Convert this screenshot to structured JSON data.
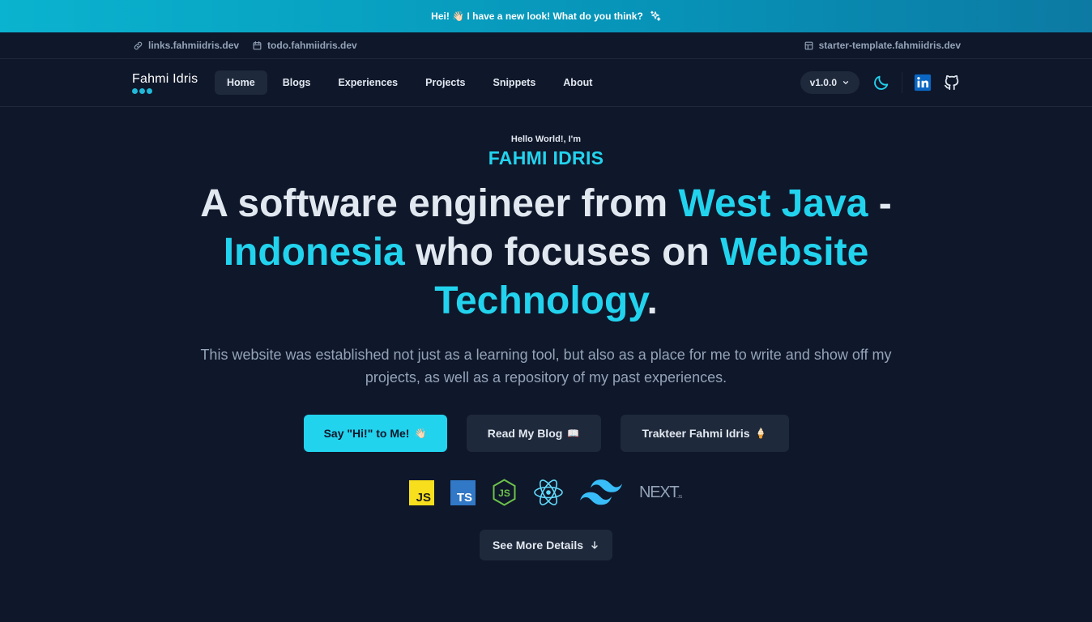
{
  "announcement": {
    "text": "Hei! 👋🏻 I have a new look! What do you think?",
    "icon": "sparkles-icon"
  },
  "topbar": {
    "links": [
      {
        "label": "links.fahmiidris.dev",
        "icon": "link-icon"
      },
      {
        "label": "todo.fahmiidris.dev",
        "icon": "calendar-icon"
      }
    ],
    "right_link": {
      "label": "starter-template.fahmiidris.dev",
      "icon": "layout-icon"
    }
  },
  "navbar": {
    "logo": "Fahmi Idris",
    "items": [
      {
        "label": "Home",
        "active": true
      },
      {
        "label": "Blogs"
      },
      {
        "label": "Experiences"
      },
      {
        "label": "Projects"
      },
      {
        "label": "Snippets"
      },
      {
        "label": "About"
      }
    ],
    "version": "v1.0.0",
    "icons": [
      "moon-icon",
      "linkedin-icon",
      "github-icon"
    ]
  },
  "hero": {
    "greeting": "Hello World!, I'm",
    "name": "FAHMI IDRIS",
    "headline": {
      "p1": "A software engineer from ",
      "h1": "West Java",
      "p2": " - ",
      "h2": "Indonesia",
      "p3": " who focuses on ",
      "h3": "Website Technology",
      "p4": "."
    },
    "description": "This website was established not just as a learning tool, but also as a place for me to write and show off my projects, as well as a repository of my past experiences."
  },
  "buttons": {
    "say_hi": {
      "label": "Say \"Hi!\" to Me!",
      "emoji": "👋🏻"
    },
    "read_blog": {
      "label": "Read My Blog",
      "emoji": "📖"
    },
    "trakteer": {
      "label": "Trakteer Fahmi Idris",
      "emoji": "🍦"
    }
  },
  "tech_stack": [
    "javascript-icon",
    "typescript-icon",
    "nodejs-icon",
    "react-icon",
    "tailwind-icon",
    "nextjs-icon"
  ],
  "tech_labels": {
    "js": "JS",
    "ts": "TS",
    "node": "JS",
    "next": "NEXT",
    "next_sub": ".JS"
  },
  "see_more": {
    "label": "See More Details"
  },
  "colors": {
    "background": "#0f172a",
    "accent": "#22d3ee",
    "surface": "#1e293b",
    "muted": "#94a3b8",
    "banner": "#0ab3cf"
  }
}
